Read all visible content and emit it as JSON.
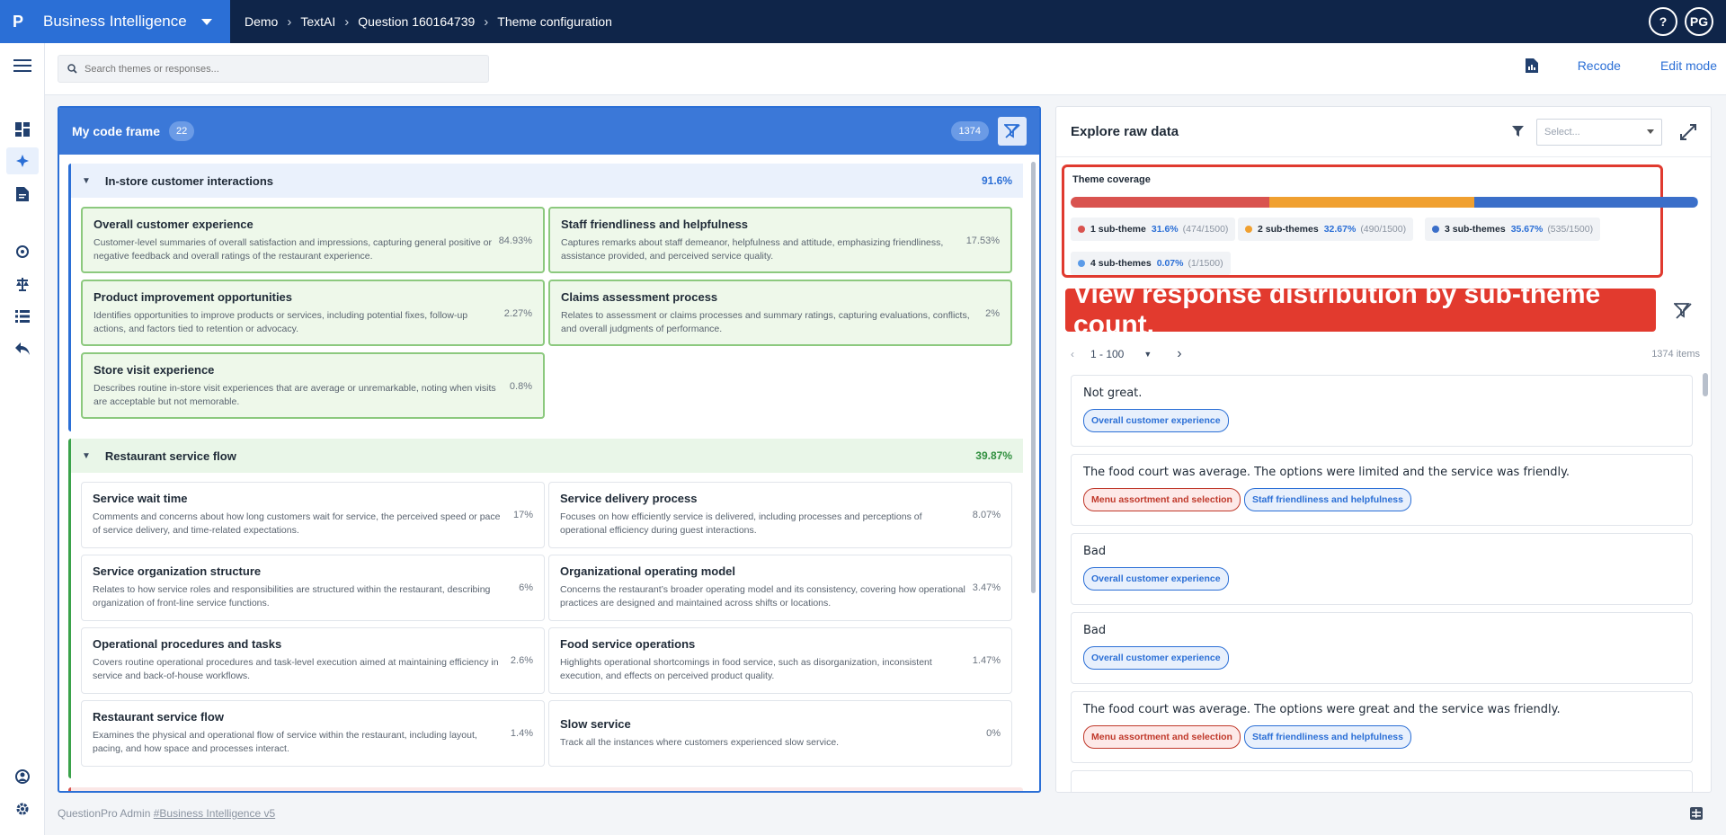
{
  "topbar": {
    "logo": "P",
    "app_title": "Business Intelligence",
    "breadcrumbs": [
      "Demo",
      "TextAI",
      "Question 160164739",
      "Theme configuration"
    ],
    "help_label": "?",
    "avatar_initials": "PG"
  },
  "search": {
    "placeholder": "Search themes or responses..."
  },
  "actions": {
    "recode": "Recode",
    "edit_mode": "Edit mode"
  },
  "codeframe": {
    "title": "My code frame",
    "count": "22",
    "total": "1374",
    "groups": [
      {
        "name": "In-store customer interactions",
        "pct": "91.6%",
        "cards": [
          {
            "title": "Overall customer experience",
            "desc": "Customer-level summaries of overall satisfaction and impressions, capturing general positive or negative feedback and overall ratings of the restaurant experience.",
            "pct": "84.93%"
          },
          {
            "title": "Staff friendliness and helpfulness",
            "desc": "Captures remarks about staff demeanor, helpfulness and attitude, emphasizing friendliness, assistance provided, and perceived service quality.",
            "pct": "17.53%"
          },
          {
            "title": "Product improvement opportunities",
            "desc": "Identifies opportunities to improve products or services, including potential fixes, follow-up actions, and factors tied to retention or advocacy.",
            "pct": "2.27%"
          },
          {
            "title": "Claims assessment process",
            "desc": "Relates to assessment or claims processes and summary ratings, capturing evaluations, conflicts, and overall judgments of performance.",
            "pct": "2%"
          },
          {
            "title": "Store visit experience",
            "desc": "Describes routine in-store visit experiences that are average or unremarkable, noting when visits are acceptable but not memorable.",
            "pct": "0.8%"
          }
        ]
      },
      {
        "name": "Restaurant service flow",
        "pct": "39.87%",
        "cards": [
          {
            "title": "Service wait time",
            "desc": "Comments and concerns about how long customers wait for service, the perceived speed or pace of service delivery, and time-related expectations.",
            "pct": "17%"
          },
          {
            "title": "Service delivery process",
            "desc": "Focuses on how efficiently service is delivered, including processes and perceptions of operational efficiency during guest interactions.",
            "pct": "8.07%"
          },
          {
            "title": "Service organization structure",
            "desc": "Relates to how service roles and responsibilities are structured within the restaurant, describing organization of front-line service functions.",
            "pct": "6%"
          },
          {
            "title": "Organizational operating model",
            "desc": "Concerns the restaurant’s broader operating model and its consistency, covering how operational practices are designed and maintained across shifts or locations.",
            "pct": "3.47%"
          },
          {
            "title": "Operational procedures and tasks",
            "desc": "Covers routine operational procedures and task-level execution aimed at maintaining efficiency in service and back-of-house workflows.",
            "pct": "2.6%"
          },
          {
            "title": "Food service operations",
            "desc": "Highlights operational shortcomings in food service, such as disorganization, inconsistent execution, and effects on perceived product quality.",
            "pct": "1.47%"
          },
          {
            "title": "Restaurant service flow",
            "desc": "Examines the physical and operational flow of service within the restaurant, including layout, pacing, and how space and processes interact.",
            "pct": "1.4%"
          },
          {
            "title": "Slow service",
            "desc": "Track all the instances where customers experienced slow service.",
            "pct": "0%"
          }
        ]
      }
    ]
  },
  "explore": {
    "title": "Explore raw data",
    "select_placeholder": "Select...",
    "coverage": {
      "title": "Theme coverage",
      "segments": [
        {
          "name": "1 sub-theme",
          "pct": "31.6%",
          "count": "(474/1500)",
          "value": 31.6,
          "color": "#d9534f"
        },
        {
          "name": "2 sub-themes",
          "pct": "32.67%",
          "count": "(490/1500)",
          "value": 32.67,
          "color": "#f0a030"
        },
        {
          "name": "3 sub-themes",
          "pct": "35.67%",
          "count": "(535/1500)",
          "value": 35.67,
          "color": "#3b6fc9"
        },
        {
          "name": "4 sub-themes",
          "pct": "0.07%",
          "count": "(1/1500)",
          "value": 0.07,
          "color": "#5b9be8"
        }
      ]
    },
    "callout": "View response distribution by sub-theme count.",
    "pager": {
      "range": "1 - 100",
      "items": "1374 items"
    },
    "responses": [
      {
        "text": "Not great.",
        "tags": [
          {
            "label": "Overall customer experience",
            "kind": "blue"
          }
        ]
      },
      {
        "text": "The food court was average. The options were limited and the service was friendly.",
        "tags": [
          {
            "label": "Menu assortment and selection",
            "kind": "red"
          },
          {
            "label": "Staff friendliness and helpfulness",
            "kind": "blue"
          }
        ]
      },
      {
        "text": "Bad",
        "tags": [
          {
            "label": "Overall customer experience",
            "kind": "blue"
          }
        ]
      },
      {
        "text": "Bad",
        "tags": [
          {
            "label": "Overall customer experience",
            "kind": "blue"
          }
        ]
      },
      {
        "text": "The food court was average. The options were great and the service was friendly.",
        "tags": [
          {
            "label": "Menu assortment and selection",
            "kind": "red"
          },
          {
            "label": "Staff friendliness and helpfulness",
            "kind": "blue"
          }
        ]
      }
    ]
  },
  "footer": {
    "prefix": "QuestionPro Admin",
    "link": "#Business Intelligence v5"
  },
  "colors": {
    "topbar": "#0f2549",
    "brand": "#2b6fd6",
    "accent": "#2b6fd6",
    "callout": "#e23a2e"
  }
}
